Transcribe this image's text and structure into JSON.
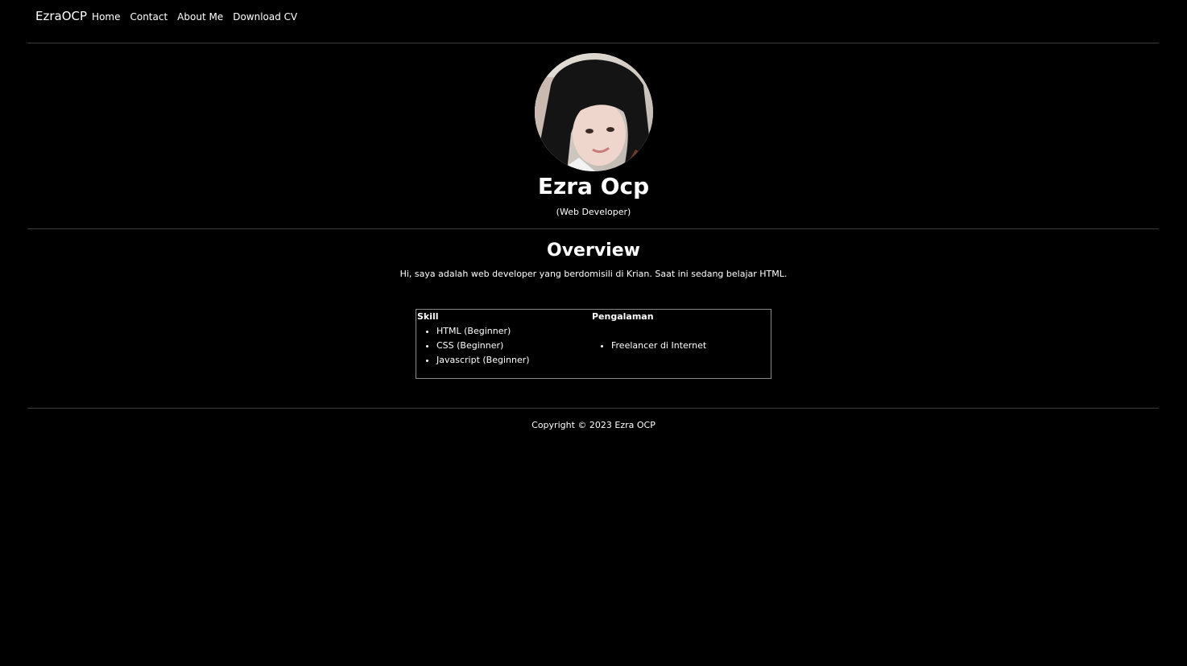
{
  "nav": {
    "brand": "EzraOCP",
    "links": [
      "Home",
      "Contact",
      "About Me",
      "Download CV"
    ]
  },
  "profile": {
    "name": "Ezra Ocp",
    "role": "(Web Developer)"
  },
  "overview": {
    "title": "Overview",
    "text": "Hi, saya adalah web developer yang berdomisili di Krian. Saat ini sedang belajar HTML."
  },
  "table": {
    "skill_header": "Skill",
    "skills": [
      "HTML (Beginner)",
      "CSS (Beginner)",
      "Javascript (Beginner)"
    ],
    "experience_header": "Pengalaman",
    "experiences": [
      "Freelancer di Internet"
    ]
  },
  "footer": {
    "copyright": "Copyright © 2023 Ezra OCP"
  }
}
